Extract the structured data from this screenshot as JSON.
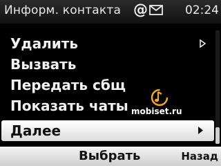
{
  "status_bar": {
    "title": "Информ. контакта",
    "at_symbol": "@",
    "mail_icon": "envelope-icon",
    "time": "02:24"
  },
  "menu": {
    "items": [
      {
        "label": "Удалить",
        "submenu": true,
        "arrow_icon": "triangle-right-outline-icon"
      },
      {
        "label": "Вызвать"
      },
      {
        "label": "Передать сбщ"
      },
      {
        "label": "Показать чаты"
      },
      {
        "label": "Далее",
        "submenu": true,
        "selected": true,
        "arrow_icon": "triangle-right-filled-icon"
      }
    ]
  },
  "watermark": {
    "text": "mobiset.ru",
    "icon": "music-note-logo-icon",
    "color": "#f5a623"
  },
  "softkeys": {
    "center": "Выбрать",
    "right": "Назад"
  }
}
